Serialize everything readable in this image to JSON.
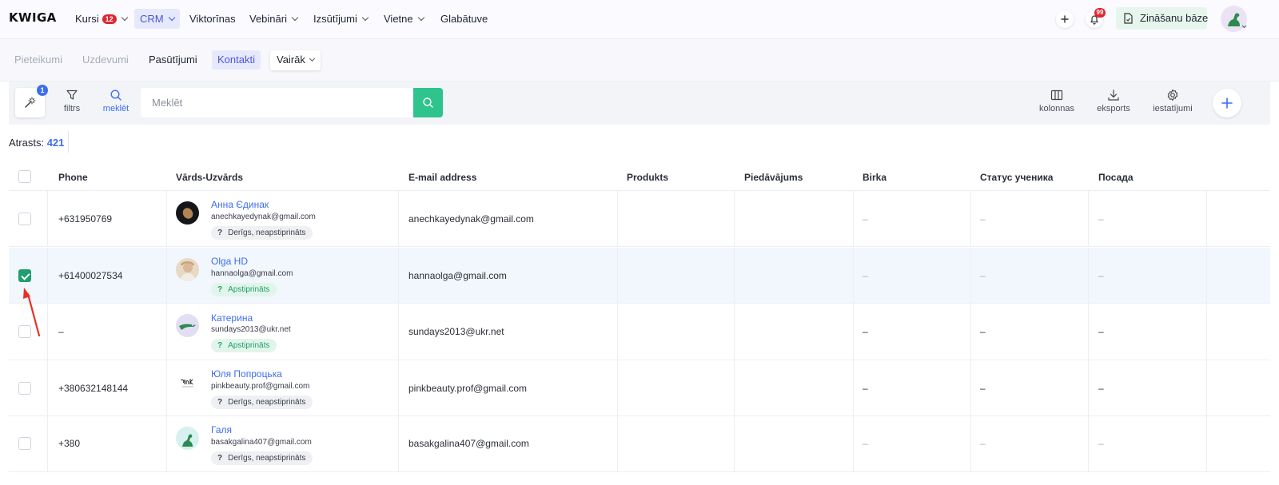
{
  "app": {
    "logo": "KWIGA"
  },
  "topnav": {
    "items": [
      {
        "label": "Kursi",
        "badge": "12",
        "dropdown": true
      },
      {
        "label": "CRM",
        "dropdown": true,
        "active": true
      },
      {
        "label": "Viktorīnas",
        "dropdown": false
      },
      {
        "label": "Vebināri",
        "dropdown": true
      },
      {
        "label": "Izsūtījumi",
        "dropdown": true
      },
      {
        "label": "Vietne",
        "dropdown": true
      },
      {
        "label": "Glabātuve",
        "dropdown": false
      }
    ],
    "notifications_count": "99",
    "knowledge_base_label": "Zināšanu bāze"
  },
  "subnav": {
    "items": [
      {
        "label": "Pieteikumi"
      },
      {
        "label": "Uzdevumi"
      },
      {
        "label": "Pasūtījumi"
      },
      {
        "label": "Kontakti",
        "active": true
      }
    ],
    "more_label": "Vairāk"
  },
  "toolbar": {
    "magic_badge": "1",
    "filter_label": "filtrs",
    "search_label": "meklēt",
    "search_placeholder": "Meklēt",
    "columns_label": "kolonnas",
    "export_label": "eksports",
    "settings_label": "iestatījumi"
  },
  "results": {
    "label": "Atrasts:",
    "count": "421"
  },
  "table": {
    "headers": [
      "Phone",
      "Vārds-Uzvārds",
      "E-mail address",
      "Produkts",
      "Piedāvājums",
      "Birka",
      "Статус ученика",
      "Посада"
    ],
    "rows": [
      {
        "phone": "+631950769",
        "name": "Анна Єдинак",
        "email_small": "anechkayedynak@gmail.com",
        "status": "Derīgs, neapstiprināts",
        "status_type": "gray",
        "email": "anechkayedynak@gmail.com",
        "checked": false,
        "dash": "–"
      },
      {
        "phone": "+61400027534",
        "name": "Olga HD",
        "email_small": "hannaolga@gmail.com",
        "status": "Apstiprināts",
        "status_type": "green",
        "email": "hannaolga@gmail.com",
        "checked": true,
        "dash": "–"
      },
      {
        "phone": "–",
        "name": "Катерина",
        "email_small": "sundays2013@ukr.net",
        "status": "Apstiprināts",
        "status_type": "green",
        "email": "sundays2013@ukr.net",
        "checked": false,
        "dash": "–"
      },
      {
        "phone": "+380632148144",
        "name": "Юля Попроцька",
        "email_small": "pinkbeauty.prof@gmail.com",
        "status": "Derīgs, neapstiprināts",
        "status_type": "gray",
        "email": "pinkbeauty.prof@gmail.com",
        "checked": false,
        "dash": "–"
      },
      {
        "phone": "+380",
        "name": "Галя",
        "email_small": "basakgalina407@gmail.com",
        "status": "Derīgs, neapstiprināts",
        "status_type": "gray",
        "email": "basakgalina407@gmail.com",
        "checked": false,
        "dash": "–"
      }
    ],
    "status_icon": "?"
  },
  "colors": {
    "accent": "#3d6ef0",
    "green": "#2fc48d",
    "check": "#1f9e6e",
    "red": "#e0252f"
  }
}
